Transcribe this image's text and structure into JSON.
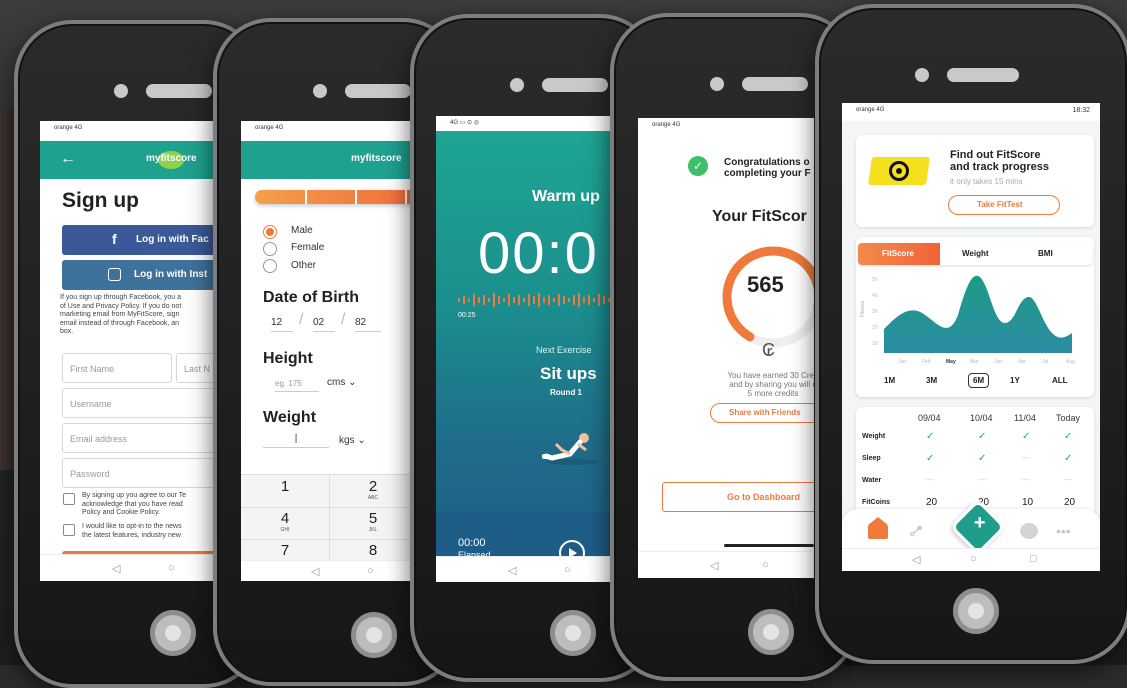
{
  "status": {
    "carrier": "orange",
    "network": "4G",
    "time": "18:32"
  },
  "screen1": {
    "brand": "myfitscore",
    "title": "Sign up",
    "facebook_btn": "Log in with Fac",
    "instagram_btn": "Log in with Inst",
    "info_text": [
      "If you sign up through Facebook, you a",
      "of Use and Privacy Policy. If you do not",
      "marketing email from MyFitScore, sign",
      "email instead of through Facebook, an",
      "box."
    ],
    "first_name": "First Name",
    "last_name": "Last N",
    "username": "Username",
    "email": "Email address",
    "password": "Password",
    "terms_text": [
      "By signing up you agree to our Te",
      "acknowledge that you have read",
      "Policy and Cookie Policy."
    ],
    "optin_text": [
      "I would like to opt-in to the news",
      "the latest features, industry new"
    ]
  },
  "screen2": {
    "brand": "myfitscore",
    "genders": [
      "Male",
      "Female",
      "Other"
    ],
    "dob_title": "Date of Birth",
    "dob": {
      "day": "12",
      "month": "02",
      "year": "82"
    },
    "height_title": "Height",
    "height_placeholder": "eg. 175",
    "height_unit": "cms",
    "weight_title": "Weight",
    "weight_unit": "kgs",
    "keypad": [
      {
        "num": "1",
        "letters": ""
      },
      {
        "num": "2",
        "letters": "ABC"
      },
      {
        "num": "4",
        "letters": "GHI"
      },
      {
        "num": "5",
        "letters": "JKL"
      },
      {
        "num": "7",
        "letters": ""
      },
      {
        "num": "8",
        "letters": ""
      }
    ]
  },
  "screen3": {
    "title": "Warm up",
    "timer": "00:0",
    "elapsed_small": "00:25",
    "next_label": "Next Exercise",
    "exercise": "Sit ups",
    "round": "Round 1",
    "elapsed_time": "00:00",
    "elapsed_label": "Elapsed"
  },
  "screen4": {
    "congrats": [
      "Congratulations o",
      "completing your F"
    ],
    "title": "Your FitScor",
    "score": "565",
    "score_fraction": 0.7,
    "earned": [
      "You have earned 30 Cred",
      "and by sharing you will e",
      "5 more credits"
    ],
    "share_btn": "Share with Friends",
    "dashboard_btn": "Go to Dashboard"
  },
  "screen5": {
    "find_title": [
      "Find out FitScore",
      "and track progress"
    ],
    "find_sub": "it only takes 15 mins",
    "take_btn": "Take FitTest",
    "tabs": [
      "FitScore",
      "Weight",
      "BMI"
    ],
    "y_ticks": [
      "50",
      "40",
      "30",
      "20",
      "10"
    ],
    "y_label": "Fitness",
    "months": [
      "Jan",
      "Feb",
      "May",
      "Mar",
      "Jun",
      "Apr",
      "Jul",
      "Aug"
    ],
    "ranges": [
      "1M",
      "3M",
      "6M",
      "1Y",
      "ALL"
    ],
    "selected_range": "6M",
    "table": {
      "dates": [
        "09/04",
        "10/04",
        "11/04",
        "Today"
      ],
      "rows": [
        {
          "label": "Weight",
          "cells": [
            "✓",
            "✓",
            "✓",
            "✓"
          ]
        },
        {
          "label": "Sleep",
          "cells": [
            "✓",
            "✓",
            "—",
            "✓"
          ]
        },
        {
          "label": "Water",
          "cells": [
            "—",
            "—",
            "—",
            "—"
          ]
        },
        {
          "label": "FitCoins",
          "cells": [
            "20",
            "20",
            "10",
            "20"
          ]
        }
      ]
    },
    "add_icon": "+"
  },
  "colors": {
    "teal": "#1ea18f",
    "orange": "#f07a3c",
    "facebook": "#3b5998",
    "instagram": "#3f729b"
  }
}
